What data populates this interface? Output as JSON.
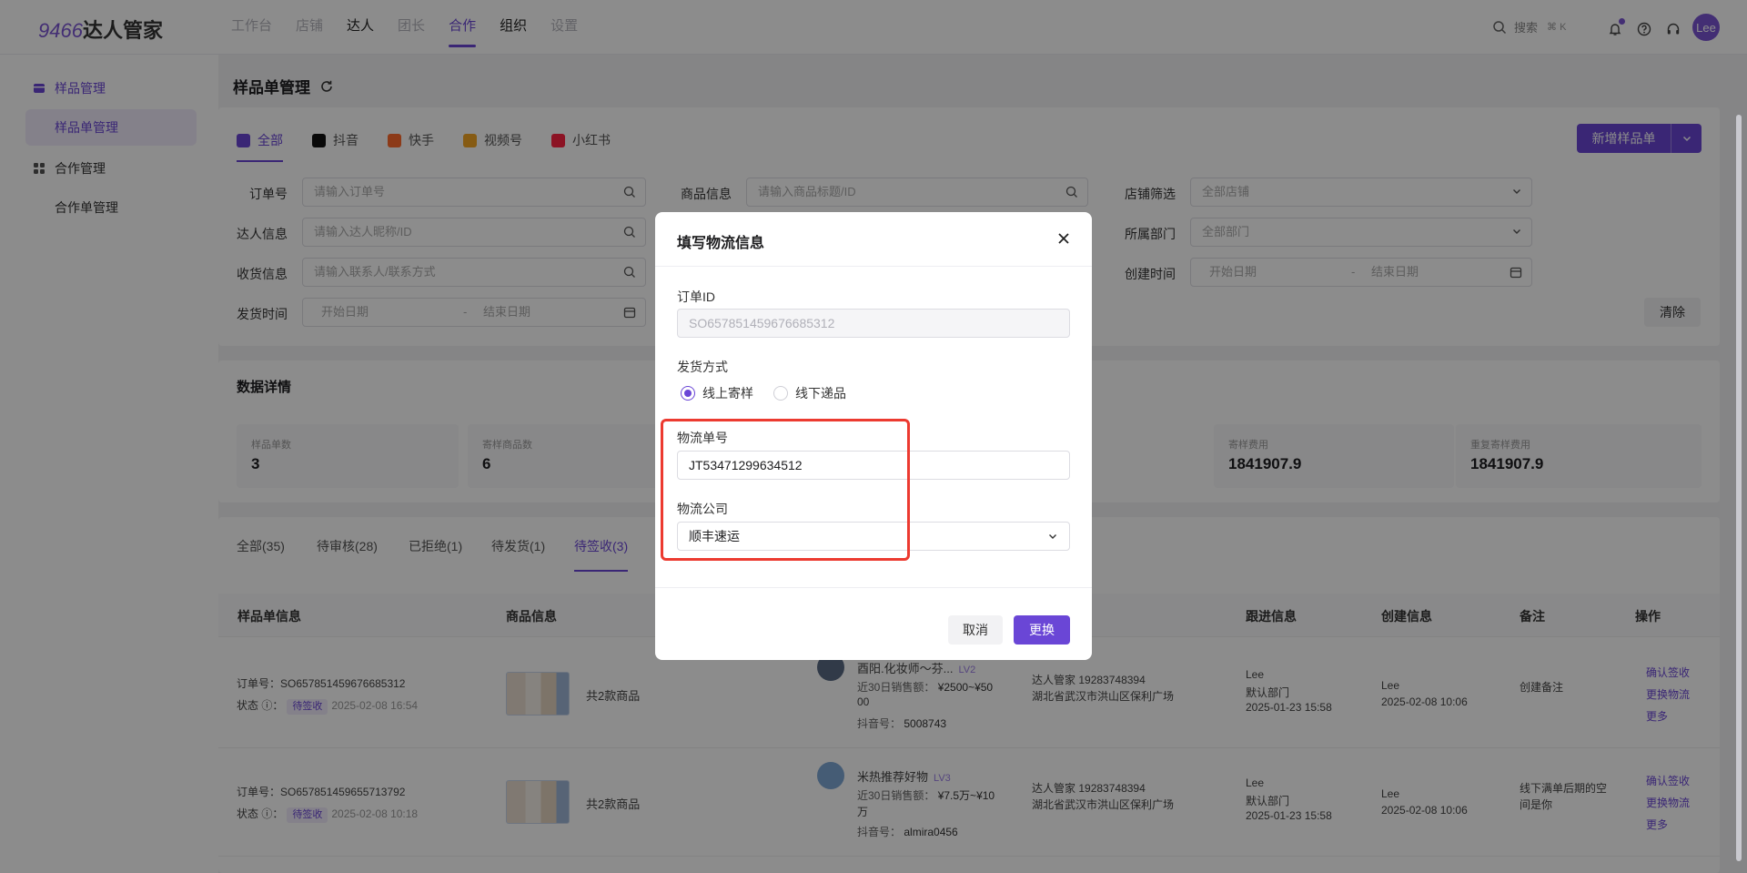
{
  "app": {
    "logo_num": "9466",
    "logo_text": "达人管家"
  },
  "nav": [
    {
      "label": "工作台",
      "state": "dim"
    },
    {
      "label": "店铺",
      "state": "dim"
    },
    {
      "label": "达人",
      "state": "normal"
    },
    {
      "label": "团长",
      "state": "dim"
    },
    {
      "label": "合作",
      "state": "active"
    },
    {
      "label": "组织",
      "state": "normal"
    },
    {
      "label": "设置",
      "state": "dim"
    }
  ],
  "header": {
    "search_label": "搜索",
    "search_shortcut": "⌘ K",
    "user_name": "Lee"
  },
  "sidebar": {
    "group1": "样品管理",
    "item1": "样品单管理",
    "group2": "合作管理",
    "item2": "合作单管理"
  },
  "page": {
    "title": "样品单管理"
  },
  "platform_tabs": [
    {
      "label": "全部",
      "active": true,
      "color": "#6a46d6"
    },
    {
      "label": "抖音",
      "active": false,
      "color": "#111111"
    },
    {
      "label": "快手",
      "active": false,
      "color": "#ff6b2c"
    },
    {
      "label": "视频号",
      "active": false,
      "color": "#f5a623"
    },
    {
      "label": "小红书",
      "active": false,
      "color": "#ff2442"
    }
  ],
  "new_button": "新增样品单",
  "filters": {
    "order_no": {
      "label": "订单号",
      "placeholder": "请输入订单号"
    },
    "product": {
      "label": "商品信息",
      "placeholder": "请输入商品标题/ID"
    },
    "shop": {
      "label": "店铺筛选",
      "value": "全部店铺"
    },
    "kol": {
      "label": "达人信息",
      "placeholder": "请输入达人昵称/ID"
    },
    "dept": {
      "label": "所属部门",
      "value": "全部部门"
    },
    "receiver": {
      "label": "收货信息",
      "placeholder": "请输入联系人/联系方式"
    },
    "created": {
      "label": "创建时间",
      "start": "开始日期",
      "end": "结束日期"
    },
    "shipped": {
      "label": "发货时间",
      "start": "开始日期",
      "end": "结束日期"
    },
    "clear": "清除"
  },
  "stats": {
    "title": "数据详情",
    "items": [
      {
        "label": "样品单数",
        "value": "3"
      },
      {
        "label": "寄样商品数",
        "value": "6"
      },
      {
        "label": "寄样费用",
        "value": "1841907.9"
      },
      {
        "label": "重复寄样费用",
        "value": "1841907.9"
      }
    ]
  },
  "status_tabs": [
    "全部(35)",
    "待审核(28)",
    "已拒绝(1)",
    "待发货(1)",
    "待签收(3)"
  ],
  "table": {
    "headers": [
      "样品单信息",
      "商品信息",
      "跟进信息",
      "创建信息",
      "备注",
      "操作"
    ],
    "order_label": "订单号：",
    "status_label": "状态",
    "rows": [
      {
        "order": "SO657851459676685312",
        "status": "待签收",
        "status_time": "2025-02-08 16:54",
        "goods": "共2款商品",
        "kol_name": "酉阳.化妆师～芬...",
        "kol_level": "LV2",
        "sales_label": "近30日销售额：",
        "sales_l1": "¥2500~¥50",
        "sales_l2": "00",
        "dy_label": "抖音号：",
        "dy_id": "5008743",
        "contact_role": "达人管家",
        "contact_phone": "19283748394",
        "address": "湖北省武汉市洪山区保利广场",
        "follow_name": "Lee",
        "follow_dept": "默认部门",
        "follow_time": "2025-01-23 15:58",
        "create_name": "Lee",
        "create_time": "2025-02-08 10:06",
        "remark_l1": "创建备注",
        "remark_l2": "",
        "actions": [
          "确认签收",
          "更换物流",
          "更多"
        ]
      },
      {
        "order": "SO657851459655713792",
        "status": "待签收",
        "status_time": "2025-02-08 10:18",
        "goods": "共2款商品",
        "kol_name": "米热推荐好物",
        "kol_level": "LV3",
        "sales_label": "近30日销售额：",
        "sales_l1": "¥7.5万~¥10",
        "sales_l2": "万",
        "dy_label": "抖音号：",
        "dy_id": "almira0456",
        "contact_role": "达人管家",
        "contact_phone": "19283748394",
        "address": "湖北省武汉市洪山区保利广场",
        "follow_name": "Lee",
        "follow_dept": "默认部门",
        "follow_time": "2025-01-23 15:58",
        "create_name": "Lee",
        "create_time": "2025-02-08 10:06",
        "remark_l1": "线下满单后期的空",
        "remark_l2": "间是你",
        "actions": [
          "确认签收",
          "更换物流",
          "更多"
        ]
      }
    ]
  },
  "modal": {
    "title": "填写物流信息",
    "order_id_label": "订单ID",
    "order_id_value": "SO657851459676685312",
    "ship_method_label": "发货方式",
    "ship_online": "线上寄样",
    "ship_offline": "线下递品",
    "tracking_label": "物流单号",
    "tracking_value": "JT53471299634512",
    "company_label": "物流公司",
    "company_value": "顺丰速运",
    "cancel": "取消",
    "confirm": "更换"
  },
  "colors": {
    "accent": "#6a46d6",
    "highlight": "#ec3a30"
  }
}
